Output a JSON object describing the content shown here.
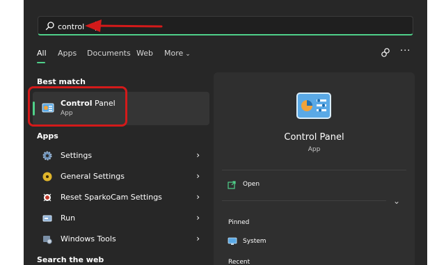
{
  "search": {
    "value": "control",
    "icon": "search-icon"
  },
  "tabs": [
    {
      "label": "All",
      "active": true
    },
    {
      "label": "Apps"
    },
    {
      "label": "Documents"
    },
    {
      "label": "Web"
    },
    {
      "label": "More"
    }
  ],
  "header_icons": [
    "share-icon",
    "more-options-icon"
  ],
  "more_dots": "···",
  "best_match": {
    "section_label": "Best match",
    "title_bold": "Control",
    "title_rest": " Panel",
    "subtitle": "App",
    "icon": "control-panel-icon"
  },
  "apps": {
    "section_label": "Apps",
    "items": [
      {
        "label": "Settings",
        "icon": "gear-icon"
      },
      {
        "label": "General Settings",
        "icon": "disc-icon"
      },
      {
        "label": "Reset SparkoCam Settings",
        "icon": "sparkocam-icon"
      },
      {
        "label": "Run",
        "icon": "run-icon"
      },
      {
        "label": "Windows Tools",
        "icon": "windows-tools-icon"
      }
    ]
  },
  "search_web": {
    "section_label": "Search the web"
  },
  "detail": {
    "title": "Control Panel",
    "subtitle": "App",
    "open_label": "Open",
    "pinned_label": "Pinned",
    "pinned_items": [
      {
        "label": "System",
        "icon": "system-monitor-icon"
      }
    ],
    "recent_label": "Recent"
  },
  "colors": {
    "accent": "#4fd18a",
    "highlight": "#d31a1a",
    "panel_bg": "#272727"
  }
}
